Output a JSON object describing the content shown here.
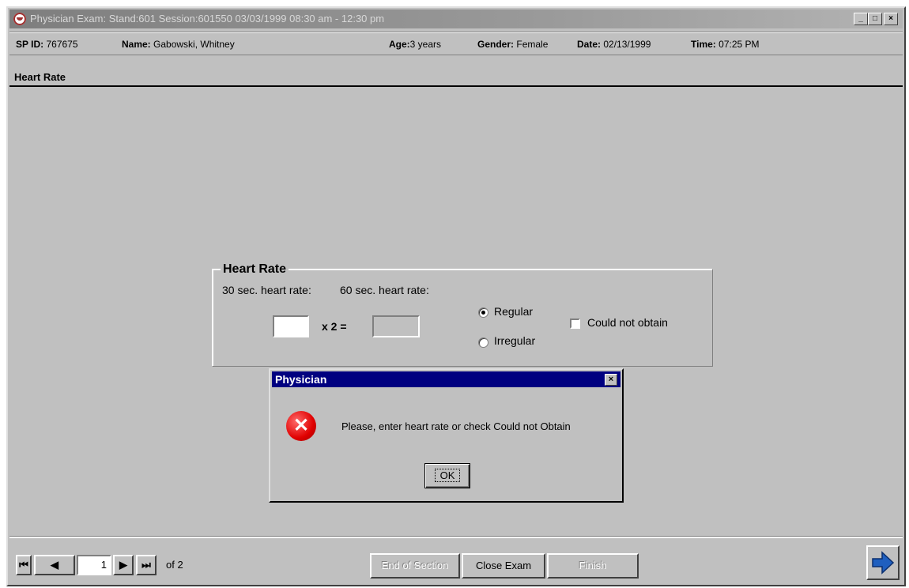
{
  "window": {
    "title": "Physician Exam: Stand:601 Session:601550 03/03/1999 08:30 am - 12:30 pm",
    "controls": {
      "minimize": "_",
      "maximize": "□",
      "close": "×"
    }
  },
  "patient": {
    "sp_id_label": "SP ID:",
    "sp_id": "767675",
    "name_label": "Name:",
    "name": "Gabowski, Whitney",
    "age_label": "Age:",
    "age": "3 years",
    "gender_label": "Gender:",
    "gender": "Female",
    "date_label": "Date:",
    "date": "02/13/1999",
    "time_label": "Time:",
    "time": "07:25 PM"
  },
  "section": {
    "title": "Heart Rate"
  },
  "heart_rate": {
    "group_label": "Heart Rate",
    "label_30": "30 sec. heart rate:",
    "label_60": "60 sec. heart rate:",
    "value_30": "",
    "multiplier": "x 2 =",
    "value_60": "",
    "rhythm_options": [
      {
        "label": "Regular",
        "selected": true
      },
      {
        "label": "Irregular",
        "selected": false
      }
    ],
    "could_not_obtain_label": "Could not obtain",
    "could_not_obtain_checked": false
  },
  "dialog": {
    "title": "Physician",
    "close": "×",
    "icon": "error-icon",
    "message": "Please, enter heart rate or check Could not Obtain",
    "ok_label": "OK"
  },
  "navigation": {
    "current_page": "1",
    "of_total": "of 2",
    "first": "first-page-icon",
    "prev": "prev-page-icon",
    "next": "next-page-icon",
    "last": "last-page-icon"
  },
  "buttons": {
    "end_of_section": "End of Section",
    "close_exam": "Close Exam",
    "finish": "Finish",
    "next_icon": "next-arrow-icon"
  },
  "colors": {
    "dialog_title_bg": "#000080",
    "error_red": "#e00000",
    "arrow_blue": "#1f5fbf"
  }
}
